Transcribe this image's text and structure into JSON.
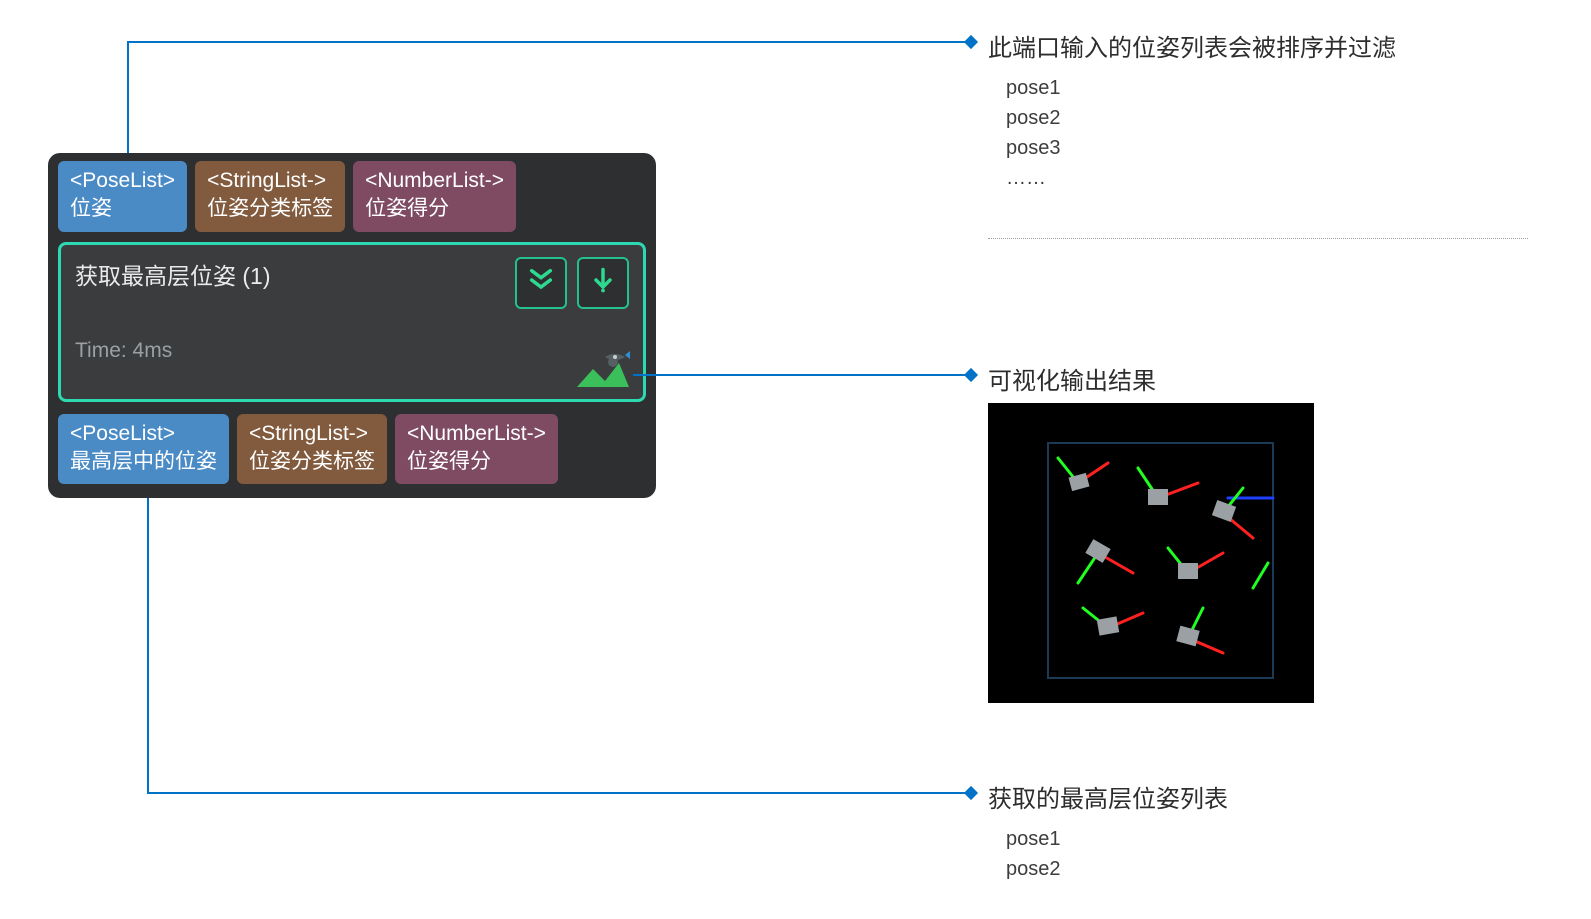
{
  "node": {
    "inputs": [
      {
        "type": "<PoseList>",
        "label": "位姿"
      },
      {
        "type": "<StringList->",
        "label": "位姿分类标签"
      },
      {
        "type": "<NumberList->",
        "label": "位姿得分"
      }
    ],
    "outputs": [
      {
        "type": "<PoseList>",
        "label": "最高层中的位姿"
      },
      {
        "type": "<StringList->",
        "label": "位姿分类标签"
      },
      {
        "type": "<NumberList->",
        "label": "位姿得分"
      }
    ],
    "title": "获取最高层位姿 (1)",
    "time": "Time: 4ms"
  },
  "callouts": {
    "top": {
      "title": "此端口输入的位姿列表会被排序并过滤",
      "lines": [
        "pose1",
        "pose2",
        "pose3",
        "……"
      ]
    },
    "mid": {
      "title": "可视化输出结果"
    },
    "bottom": {
      "title": "获取的最高层位姿列表",
      "lines": [
        "pose1",
        "pose2"
      ]
    }
  }
}
